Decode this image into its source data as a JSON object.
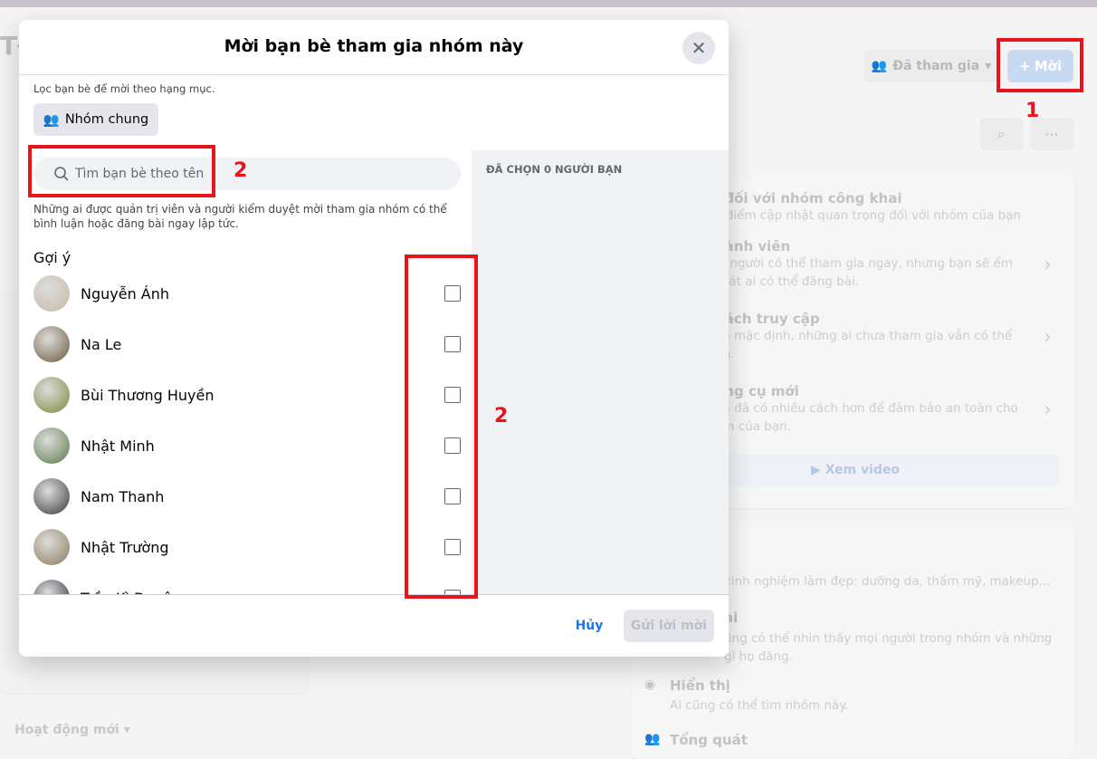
{
  "background": {
    "group_title_fragment": "Tł",
    "joined_label": "Đã tham gia",
    "invite_label": "Mời",
    "about_rows": [
      {
        "title": "i đối với nhóm công khai",
        "desc": "c điểm cập nhật quan trọng đối với nhóm của bạn"
      },
      {
        "title": "hành viên",
        "desc": "ọi người có thể tham gia ngay, nhưng bạn sẽ ểm soát ai có thể đăng bài."
      },
      {
        "title": "hách truy cập",
        "desc": "eo mặc định, những ai chưa tham gia vẫn có thể ng."
      },
      {
        "title": "ông cụ mới",
        "desc": "ện đã có nhiều cách hơn để đảm bảo an toàn cho óm của bạn."
      }
    ],
    "watch_video": "Xem video",
    "description": "kinh nghiệm làm đẹp: dưỡng da, thẩm mỹ, makeup...",
    "public_title": "ai",
    "public_desc": "ũng có thể nhìn thấy mọi người trong nhóm và những gì họ đăng.",
    "visible_title": "Hiển thị",
    "visible_desc": "Ai cũng có thể tìm nhóm này.",
    "general_title": "Tổng quát",
    "recent_activity": "Hoạt động mới"
  },
  "modal": {
    "title": "Mời bạn bè tham gia nhóm này",
    "filter_label": "Lọc bạn bè để mời theo hạng mục.",
    "filter_button": "Nhóm chung",
    "search_placeholder": "Tìm bạn bè theo tên",
    "search_value": "",
    "note": "Những ai được quản trị viên và người kiểm duyệt mời tham gia nhóm có thể bình luận hoặc đăng bài ngay lập tức.",
    "suggestions_label": "Gợi ý",
    "friends": [
      {
        "name": "Nguyễn Ánh",
        "checked": false,
        "avatar_color": "#c9b9a8"
      },
      {
        "name": "Na Le",
        "checked": false,
        "avatar_color": "#6a5a3c"
      },
      {
        "name": "Bùi Thương Huyền",
        "checked": false,
        "avatar_color": "#7a8a3a"
      },
      {
        "name": "Nhật Minh",
        "checked": false,
        "avatar_color": "#5a7a4a"
      },
      {
        "name": "Nam Thanh",
        "checked": false,
        "avatar_color": "#3a3a3a"
      },
      {
        "name": "Nhật Trường",
        "checked": false,
        "avatar_color": "#8a7a5a"
      },
      {
        "name": "Trần Kì Duyên",
        "checked": false,
        "avatar_color": "#2a2a3a"
      }
    ],
    "selected_header": "ĐÃ CHỌN 0 NGƯỜI BẠN",
    "cancel": "Hủy",
    "send": "Gửi lời mời"
  },
  "annotations": {
    "one": "1",
    "two": "2",
    "three": "2"
  },
  "colors": {
    "accent": "#1877f2",
    "annotation": "#e8141c"
  }
}
